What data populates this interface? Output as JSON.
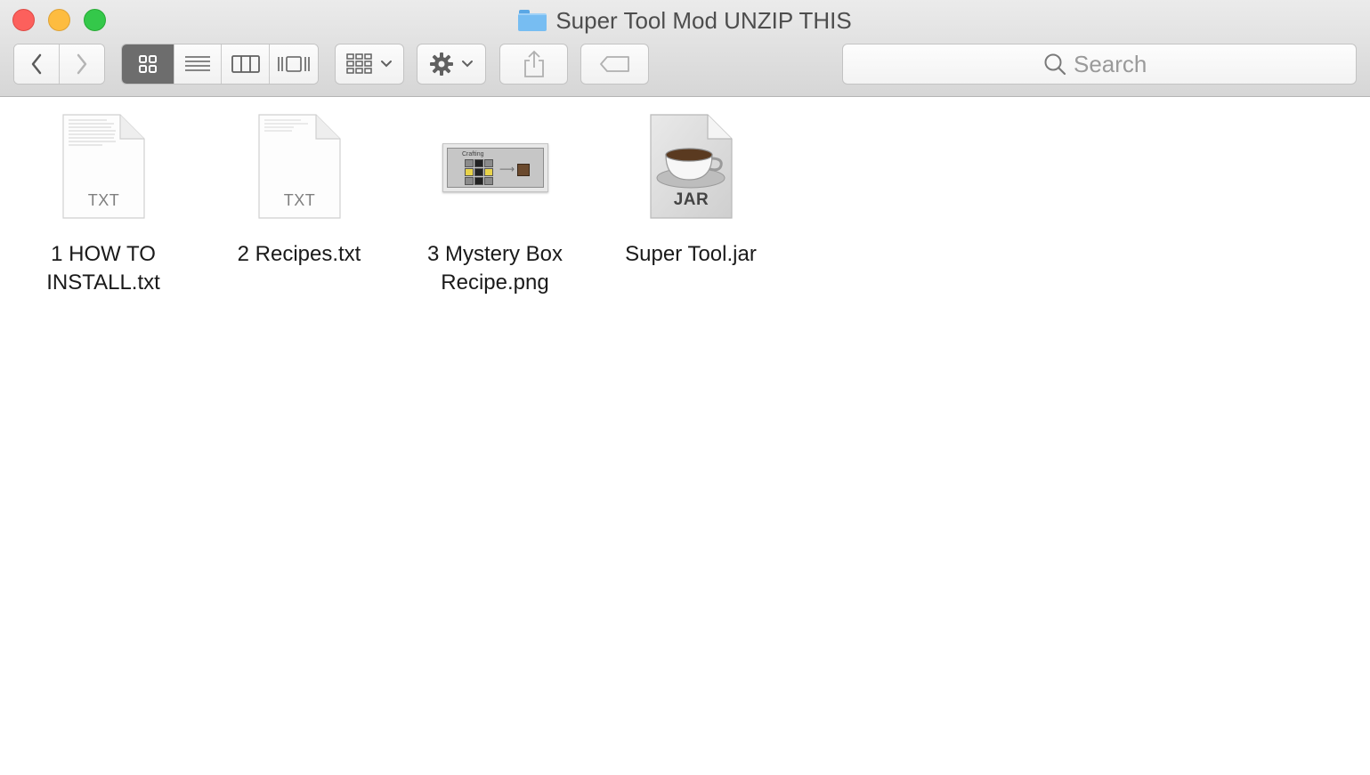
{
  "window": {
    "title": "Super Tool Mod UNZIP THIS",
    "title_icon": "folder-icon"
  },
  "toolbar": {
    "back_icon": "chevron-left-icon",
    "forward_icon": "chevron-right-icon",
    "view_modes": [
      "icon-view",
      "list-view",
      "column-view",
      "cover-flow-view"
    ],
    "active_view": "icon-view",
    "arrange_icon": "arrange-grid-icon",
    "action_icon": "gear-icon",
    "share_icon": "share-icon",
    "tag_icon": "tag-icon"
  },
  "search": {
    "placeholder": "Search"
  },
  "files": [
    {
      "name": "1 HOW TO INSTALL.txt",
      "type": "TXT"
    },
    {
      "name": "2 Recipes.txt",
      "type": "TXT"
    },
    {
      "name": "3 Mystery Box Recipe.png",
      "type": "PNG",
      "thumbnail_label": "Crafting"
    },
    {
      "name": "Super Tool.jar",
      "type": "JAR"
    }
  ],
  "colors": {
    "close": "#fc605c",
    "minimize": "#fdbc40",
    "zoom": "#34c84a",
    "folder": "#77bdf2"
  }
}
